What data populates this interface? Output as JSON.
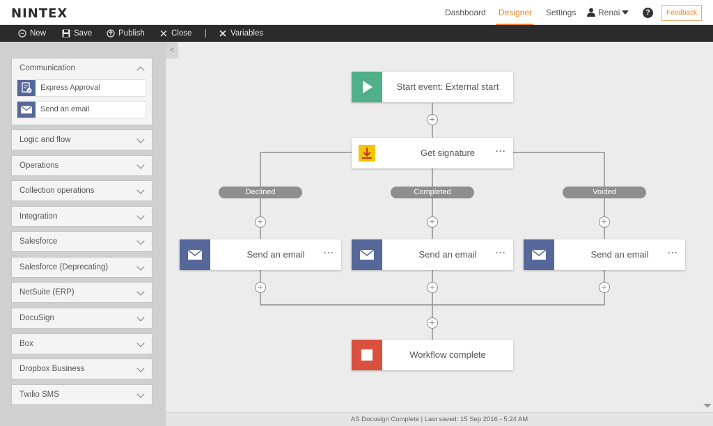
{
  "app": {
    "logo": "NINTEX"
  },
  "nav": {
    "dashboard": "Dashboard",
    "designer": "Designer",
    "settings": "Settings",
    "user": "Renai",
    "help": "?",
    "feedback": "Feedback",
    "accent_color": "#e8872a"
  },
  "toolbar": {
    "new": "New",
    "save": "Save",
    "publish": "Publish",
    "close": "Close",
    "variables": "Variables"
  },
  "sidebar": {
    "collapse_glyph": "<",
    "communication": {
      "title": "Communication",
      "actions": [
        {
          "label": "Express Approval",
          "icon": "express-approval-icon"
        },
        {
          "label": "Send an email",
          "icon": "email-icon"
        }
      ]
    },
    "groups": [
      "Logic and flow",
      "Operations",
      "Collection operations",
      "Integration",
      "Salesforce",
      "Salesforce (Deprecating)",
      "NetSuite (ERP)",
      "DocuSign",
      "Box",
      "Dropbox Business",
      "Twilio SMS"
    ]
  },
  "workflow": {
    "start": {
      "label": "Start event: External start",
      "color": "#4fb08a"
    },
    "signature": {
      "label": "Get signature",
      "more": "···",
      "color": "#f5c400"
    },
    "branches": [
      "Declined",
      "Completed",
      "Voided"
    ],
    "emails": [
      {
        "label": "Send an email",
        "more": "···"
      },
      {
        "label": "Send an email",
        "more": "···"
      },
      {
        "label": "Send an email",
        "more": "···"
      }
    ],
    "email_color": "#56689a",
    "end": {
      "label": "Workflow complete",
      "color": "#d9503f"
    }
  },
  "status": {
    "text": "AS Docusign Complete  |  Last saved: 15 Sep 2016 - 5:24 AM"
  }
}
